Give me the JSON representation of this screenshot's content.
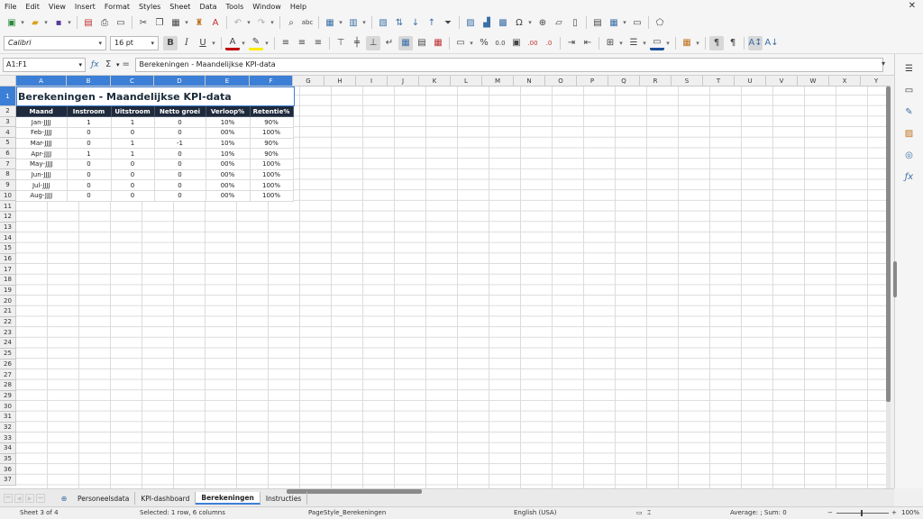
{
  "menu": [
    "File",
    "Edit",
    "View",
    "Insert",
    "Format",
    "Styles",
    "Sheet",
    "Data",
    "Tools",
    "Window",
    "Help"
  ],
  "font_name": "Calibri",
  "font_size": "16 pt",
  "name_box": "A1:F1",
  "formula": "Berekeningen - Maandelijkse KPI-data",
  "columns": [
    "A",
    "B",
    "C",
    "D",
    "E",
    "F",
    "G",
    "H",
    "I",
    "J",
    "K",
    "L",
    "M",
    "N",
    "O",
    "P",
    "Q",
    "R",
    "S",
    "T",
    "U",
    "V",
    "W",
    "X",
    "Y"
  ],
  "rows": [
    "1",
    "2",
    "3",
    "4",
    "5",
    "6",
    "7",
    "8",
    "9",
    "10",
    "11",
    "12",
    "13",
    "14",
    "15",
    "16",
    "17",
    "18",
    "19",
    "20",
    "21",
    "22",
    "23",
    "24",
    "25",
    "26",
    "27",
    "28",
    "29",
    "30",
    "31",
    "32",
    "33",
    "34",
    "35",
    "36",
    "37"
  ],
  "sheet": {
    "title": "Berekeningen - Maandelijkse KPI-data",
    "headers": [
      "Maand",
      "Instroom",
      "Uitstroom",
      "Netto groei",
      "Verloop%",
      "Retentie%"
    ],
    "data": [
      [
        "Jan-JJJJ",
        "1",
        "1",
        "0",
        "10%",
        "90%"
      ],
      [
        "Feb-JJJJ",
        "0",
        "0",
        "0",
        "00%",
        "100%"
      ],
      [
        "Mar-JJJJ",
        "0",
        "1",
        "-1",
        "10%",
        "90%"
      ],
      [
        "Apr-JJJJ",
        "1",
        "1",
        "0",
        "10%",
        "90%"
      ],
      [
        "May-JJJJ",
        "0",
        "0",
        "0",
        "00%",
        "100%"
      ],
      [
        "Jun-JJJJ",
        "0",
        "0",
        "0",
        "00%",
        "100%"
      ],
      [
        "Jul-JJJJ",
        "0",
        "0",
        "0",
        "00%",
        "100%"
      ],
      [
        "Aug-JJJJ",
        "0",
        "0",
        "0",
        "00%",
        "100%"
      ]
    ]
  },
  "tabs": [
    "Personeelsdata",
    "KPI-dashboard",
    "Berekeningen",
    "Instructies"
  ],
  "active_tab": "Berekeningen",
  "status": {
    "sheet_pos": "Sheet 3 of 4",
    "selection": "Selected: 1 row, 6 columns",
    "page_style": "PageStyle_Berekeningen",
    "language": "English (USA)",
    "sum": "Average: ; Sum: 0",
    "zoom": "100%"
  },
  "colors": {
    "selection": "#3c7fd6",
    "header_bg": "#1f2a3c"
  },
  "icons": [
    "new-icon",
    "open-icon",
    "save-icon",
    "export-pdf-icon",
    "print-icon",
    "print-preview-icon",
    "cut-icon",
    "copy-icon",
    "paste-icon",
    "clone-formatting-icon",
    "clear-formatting-icon",
    "undo-icon",
    "redo-icon",
    "find-replace-icon",
    "spellcheck-icon",
    "row-icon",
    "column-icon",
    "freeze-icon",
    "sort-icon",
    "sort-ascending-icon",
    "sort-descending-icon",
    "autofilter-icon",
    "image-icon",
    "chart-icon",
    "pivot-icon",
    "special-character-icon",
    "hyperlink-icon",
    "comment-icon",
    "header-footer-icon",
    "define-print-area-icon",
    "freeze-rows-icon",
    "split-window-icon",
    "show-draw-icon"
  ]
}
